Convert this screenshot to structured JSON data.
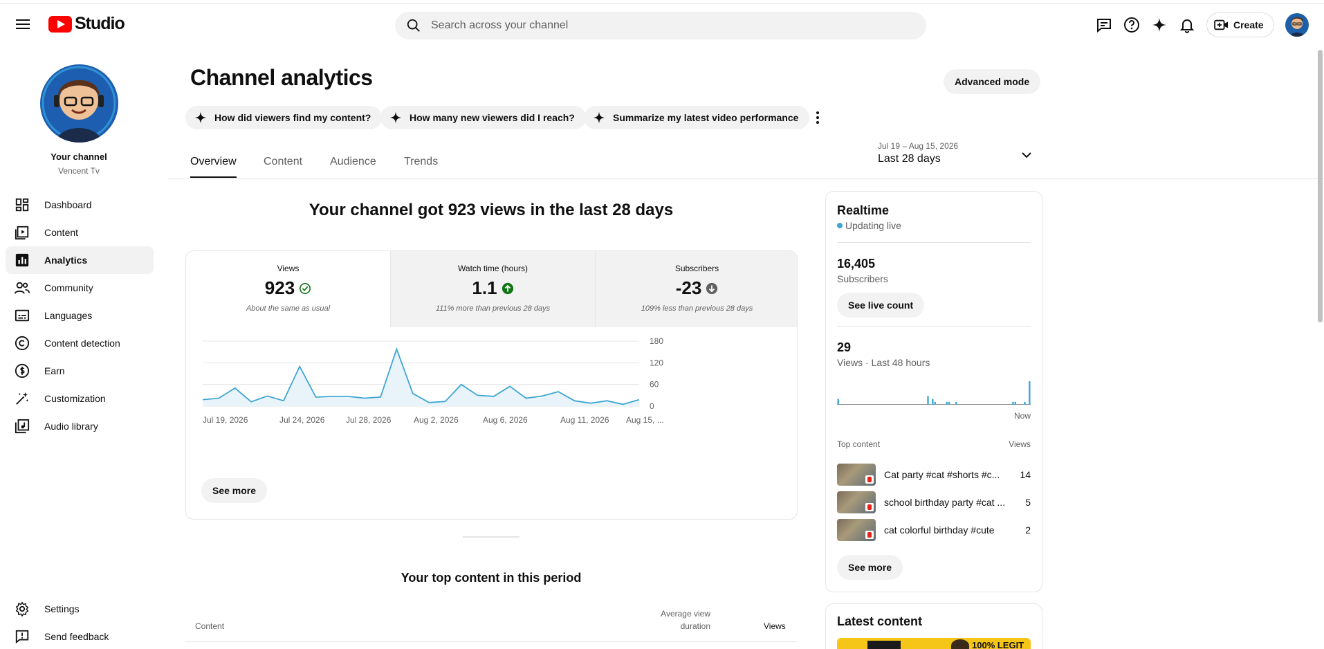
{
  "header": {
    "logo_text": "Studio",
    "search_placeholder": "Search across your channel",
    "create_label": "Create"
  },
  "sidebar": {
    "channel_label": "Your channel",
    "channel_name": "Vencent Tv",
    "items": [
      {
        "label": "Dashboard",
        "icon": "dashboard-icon"
      },
      {
        "label": "Content",
        "icon": "content-icon"
      },
      {
        "label": "Analytics",
        "icon": "analytics-icon",
        "active": true
      },
      {
        "label": "Community",
        "icon": "community-icon"
      },
      {
        "label": "Languages",
        "icon": "languages-icon"
      },
      {
        "label": "Content detection",
        "icon": "copyright-icon"
      },
      {
        "label": "Earn",
        "icon": "dollar-icon"
      },
      {
        "label": "Customization",
        "icon": "magic-wand-icon"
      },
      {
        "label": "Audio library",
        "icon": "audio-library-icon"
      }
    ],
    "bottom": [
      {
        "label": "Settings",
        "icon": "gear-icon"
      },
      {
        "label": "Send feedback",
        "icon": "feedback-icon"
      }
    ]
  },
  "main": {
    "title": "Channel analytics",
    "advanced_mode": "Advanced mode",
    "chips": [
      "How did viewers find my content?",
      "How many new viewers did I reach?",
      "Summarize my latest video performance"
    ],
    "tabs": [
      "Overview",
      "Content",
      "Audience",
      "Trends"
    ],
    "date_range": "Jul 19 – Aug 15, 2026",
    "date_label": "Last 28 days",
    "headline": "Your channel got 923 views in the last 28 days",
    "metrics": [
      {
        "label": "Views",
        "value": "923",
        "note": "About the same as usual",
        "status": "check"
      },
      {
        "label": "Watch time (hours)",
        "value": "1.1",
        "note": "111% more than previous 28 days",
        "status": "up"
      },
      {
        "label": "Subscribers",
        "value": "-23",
        "note": "109% less than previous 28 days",
        "status": "down"
      }
    ],
    "see_more": "See more",
    "top_content_heading": "Your top content in this period",
    "table_headers": {
      "content": "Content",
      "avg_view_duration_1": "Average view",
      "avg_view_duration_2": "duration",
      "views": "Views"
    }
  },
  "chart_data": {
    "type": "area",
    "x_ticks": [
      "Jul 19, 2026",
      "Jul 24, 2026",
      "Jul 28, 2026",
      "Aug 2, 2026",
      "Aug 6, 2026",
      "Aug 11, 2026",
      "Aug 15, ..."
    ],
    "y_ticks": [
      "180",
      "120",
      "60",
      "0"
    ],
    "ylim": [
      0,
      180
    ],
    "values": [
      18,
      22,
      50,
      12,
      28,
      15,
      110,
      25,
      27,
      27,
      22,
      25,
      158,
      35,
      10,
      13,
      60,
      30,
      27,
      55,
      22,
      28,
      40,
      15,
      8,
      15,
      5,
      18
    ],
    "color": "#3ea6d1"
  },
  "realtime": {
    "title": "Realtime",
    "live": "Updating live",
    "subscribers_value": "16,405",
    "subscribers_label": "Subscribers",
    "see_live_count": "See live count",
    "views_value": "29",
    "views_label": "Views · Last 48 hours",
    "now_label": "Now",
    "bars": [
      2,
      0,
      0,
      0,
      0,
      0,
      0,
      0,
      0,
      0,
      0,
      0,
      0,
      0,
      0,
      0,
      0,
      0,
      0,
      0,
      0,
      0,
      0,
      0,
      0,
      0,
      0,
      0,
      0,
      0,
      0,
      0,
      0,
      0,
      0,
      0,
      0,
      0,
      3,
      0,
      2,
      1,
      0,
      0,
      0,
      0,
      1,
      1,
      0,
      0,
      1,
      0,
      0,
      0,
      0,
      0,
      0,
      0,
      0,
      0,
      0,
      0,
      0,
      0,
      0,
      0,
      0,
      0,
      0,
      0,
      0,
      0,
      0,
      0,
      1,
      1,
      0,
      0,
      0,
      1,
      0,
      8
    ],
    "top_content_label": "Top content",
    "views_header": "Views",
    "top_content": [
      {
        "title": "Cat party #cat #shorts #c...",
        "views": "14"
      },
      {
        "title": "school birthday party #cat ...",
        "views": "5"
      },
      {
        "title": "cat colorful birthday #cute",
        "views": "2"
      }
    ],
    "see_more": "See more"
  },
  "latest": {
    "title": "Latest content",
    "thumb_text": "100% LEGIT"
  }
}
